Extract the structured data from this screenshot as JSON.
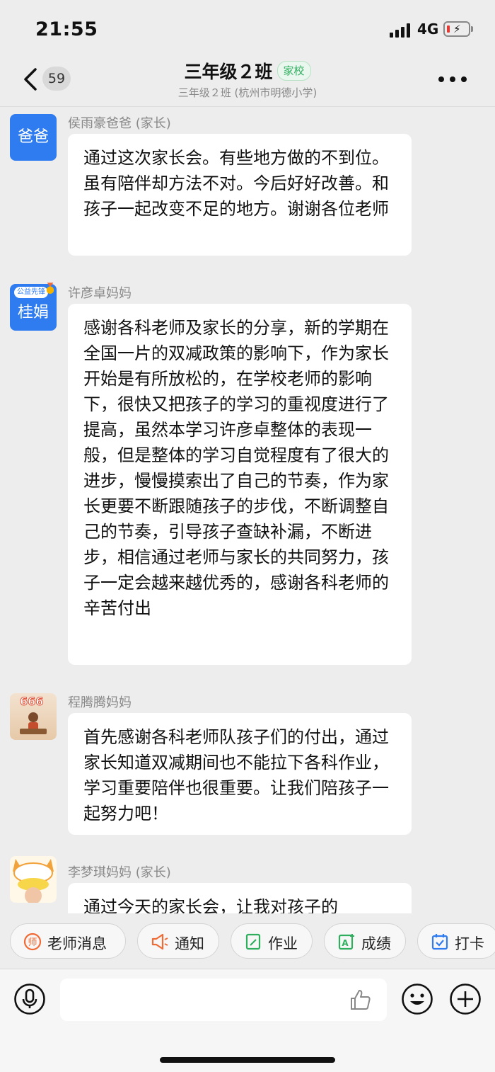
{
  "status_bar": {
    "time": "21:55",
    "network": "4G"
  },
  "header": {
    "back_count": "59",
    "title": "三年级２班",
    "tag": "家校",
    "subtitle": "三年级２班 (杭州市明德小学)"
  },
  "messages": [
    {
      "sender": "侯雨豪爸爸 (家长)",
      "avatar_text": "爸爸",
      "text": "通过这次家长会。有些地方做的不到位。虽有陪伴却方法不对。今后好好改善。和孩子一起改变不足的地方。谢谢各位老师"
    },
    {
      "sender": "许彦卓妈妈",
      "avatar_text": "桂娟",
      "avatar_badge": "公益先锋",
      "text": "感谢各科老师及家长的分享，新的学期在全国一片的双减政策的影响下，作为家长开始是有所放松的，在学校老师的影响下，很快又把孩子的学习的重视度进行了提高，虽然本学习许彦卓整体的表现一般，但是整体的学习自觉程度有了很大的进步，慢慢摸索出了自己的节奏，作为家长更要不断跟随孩子的步伐，不断调整自己的节奏，引导孩子查缺补漏，不断进步，相信通过老师与家长的共同努力，孩子一定会越来越优秀的，感谢各科老师的辛苦付出"
    },
    {
      "sender": "程腾腾妈妈",
      "avatar_badge": "666",
      "text": "首先感谢各科老师队孩子们的付出，通过家长知道双减期间也不能拉下各科作业，学习重要陪伴也很重要。让我们陪孩子一起努力吧！"
    },
    {
      "sender": "李梦琪妈妈 (家长)",
      "text": "通过今天的家长会，让我对孩子的"
    }
  ],
  "quick_actions": [
    {
      "label": "老师消息",
      "icon": "teacher-icon"
    },
    {
      "label": "通知",
      "icon": "megaphone-icon"
    },
    {
      "label": "作业",
      "icon": "homework-icon"
    },
    {
      "label": "成绩",
      "icon": "grade-icon"
    },
    {
      "label": "打卡",
      "icon": "calendar-check-icon"
    }
  ],
  "colors": {
    "accent_orange": "#f06a35",
    "accent_green": "#2fae5e",
    "accent_blue": "#2f7cf0",
    "background": "#ededed"
  }
}
